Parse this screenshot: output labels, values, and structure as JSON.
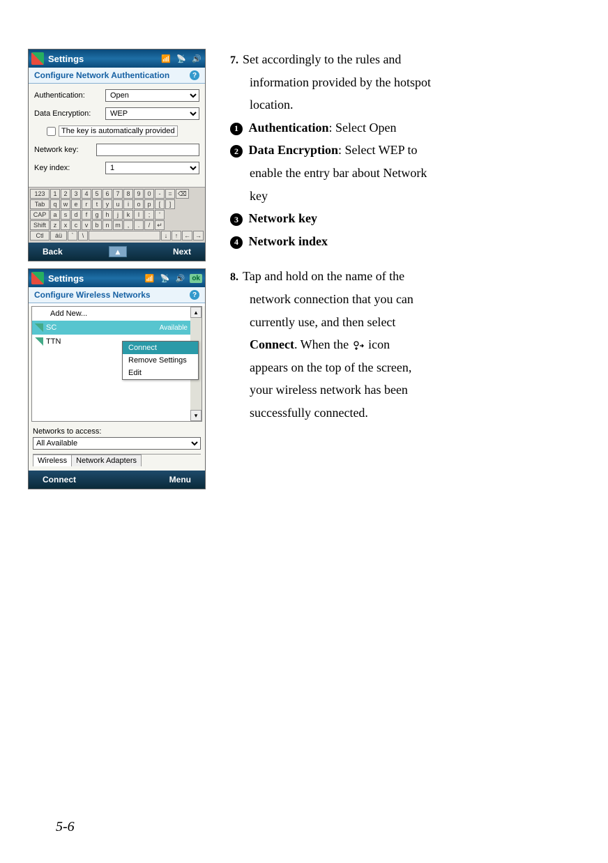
{
  "page_number": "5-6",
  "right": {
    "step7_num": "7.",
    "step7_line1": "Set accordingly to the rules and",
    "step7_line2": "information provided by the hotspot",
    "step7_line3": "location.",
    "b1": "Authentication",
    "b1_text": ": Select Open",
    "b2": "Data Encryption",
    "b2_text_a": ": Select WEP to",
    "b2_text_b": "enable the entry bar about Network",
    "b2_text_c": "key",
    "b3": "Network key",
    "b4": "Network index",
    "step8_num": "8.",
    "step8_a": "Tap and hold on the name of the",
    "step8_b": "network connection that you can",
    "step8_c": "currently use, and then select",
    "step8_d_pre": "Connect",
    "step8_d_post": ". When the ",
    "step8_d_end": " icon",
    "step8_e": "appears on the top of the screen,",
    "step8_f": "your wireless network has been",
    "step8_g": "successfully connected."
  },
  "shot1": {
    "title": "Settings",
    "subtitle": "Configure Network Authentication",
    "labels": {
      "auth": "Authentication:",
      "enc": "Data Encryption:",
      "autokey": "The key is automatically provided",
      "netkey": "Network key:",
      "keyidx": "Key index:"
    },
    "values": {
      "auth": "Open",
      "enc": "WEP",
      "keyidx": "1"
    },
    "softkeys": {
      "left": "Back",
      "right": "Next"
    },
    "kbd": {
      "r1": [
        "123",
        "1",
        "2",
        "3",
        "4",
        "5",
        "6",
        "7",
        "8",
        "9",
        "0",
        "-",
        "=",
        "⌫"
      ],
      "r2": [
        "Tab",
        "q",
        "w",
        "e",
        "r",
        "t",
        "y",
        "u",
        "i",
        "o",
        "p",
        "[",
        "]"
      ],
      "r3": [
        "CAP",
        "a",
        "s",
        "d",
        "f",
        "g",
        "h",
        "j",
        "k",
        "l",
        ";",
        "'"
      ],
      "r4": [
        "Shift",
        "z",
        "x",
        "c",
        "v",
        "b",
        "n",
        "m",
        ",",
        ".",
        "/",
        "↵"
      ],
      "r5": [
        "Ctl",
        "áü",
        "`",
        "\\",
        " ",
        "↓",
        "↑",
        "←",
        "→"
      ]
    }
  },
  "shot2": {
    "title": "Settings",
    "ok": "ok",
    "subtitle": "Configure Wireless Networks",
    "items": {
      "addnew": "Add New...",
      "sc": "SC",
      "sc_status": "Available",
      "ttn": "TTN"
    },
    "ctx": {
      "connect": "Connect",
      "remove": "Remove Settings",
      "edit": "Edit"
    },
    "access_label": "Networks to access:",
    "access_value": "All Available",
    "tabs": {
      "wireless": "Wireless",
      "adapters": "Network Adapters"
    },
    "softkeys": {
      "left": "Connect",
      "right": "Menu"
    }
  }
}
